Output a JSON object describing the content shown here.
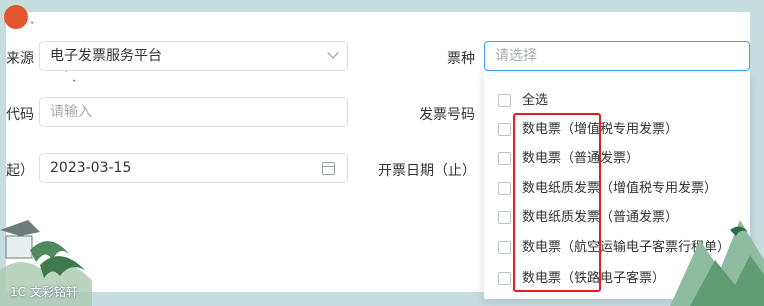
{
  "form": {
    "source_label": "来源",
    "source_value": "电子发票服务平台",
    "ticket_type_label": "票种",
    "ticket_type_placeholder": "请选择",
    "code_label": "代码",
    "code_placeholder": "请输入",
    "invoice_no_label": "发票号码",
    "date_start_label": "起）",
    "date_start_value": "2023-03-15",
    "date_end_label": "开票日期（止）"
  },
  "dropdown": {
    "options": [
      "全选",
      "数电票（增值税专用发票）",
      "数电票（普通发票）",
      "数电纸质发票（增值税专用发票）",
      "数电纸质发票（普通发票）",
      "数电票（航空运输电子客票行程单）",
      "数电票（铁路电子客票）"
    ]
  },
  "watermark": "1C 文彩铭轩",
  "colors": {
    "focus_border": "#409eff",
    "highlight_box": "#e02020",
    "background": "#cfe3e5"
  },
  "icons": [
    "chevron-down-icon",
    "calendar-icon",
    "checkbox-icon"
  ]
}
